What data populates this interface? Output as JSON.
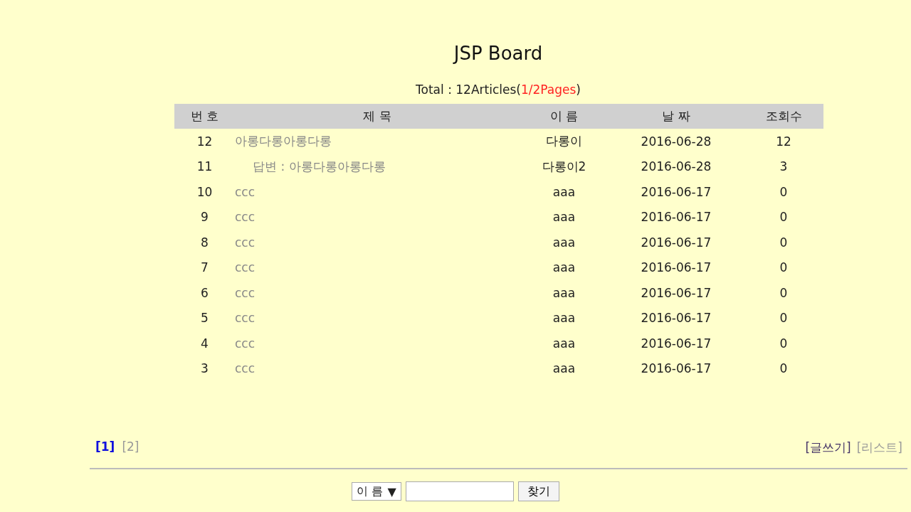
{
  "title": "JSP Board",
  "summary": {
    "total": "Total : 12Articles(",
    "pages": "1/2Pages",
    "close": ")"
  },
  "table": {
    "columns": [
      "번 호",
      "제 목",
      "이 름",
      "날 짜",
      "조회수"
    ],
    "rows": [
      {
        "no": "12",
        "title": "아롱다롱아롱다롱",
        "name": "다롱이",
        "date": "2016-06-28",
        "hits": "12",
        "children": [
          {
            "no": "11",
            "title": "답변 : 아롱다롱아롱다롱",
            "name": "다롱이2",
            "date": "2016-06-28",
            "hits": "3"
          }
        ]
      },
      {
        "no": "10",
        "title": "ccc",
        "name": "aaa",
        "date": "2016-06-17",
        "hits": "0"
      },
      {
        "no": "9",
        "title": "ccc",
        "name": "aaa",
        "date": "2016-06-17",
        "hits": "0"
      },
      {
        "no": "8",
        "title": "ccc",
        "name": "aaa",
        "date": "2016-06-17",
        "hits": "0"
      },
      {
        "no": "7",
        "title": "ccc",
        "name": "aaa",
        "date": "2016-06-17",
        "hits": "0"
      },
      {
        "no": "6",
        "title": "ccc",
        "name": "aaa",
        "date": "2016-06-17",
        "hits": "0"
      },
      {
        "no": "5",
        "title": "ccc",
        "name": "aaa",
        "date": "2016-06-17",
        "hits": "0"
      },
      {
        "no": "4",
        "title": "ccc",
        "name": "aaa",
        "date": "2016-06-17",
        "hits": "0"
      },
      {
        "no": "3",
        "title": "ccc",
        "name": "aaa",
        "date": "2016-06-17",
        "hits": "0"
      }
    ]
  },
  "pagination": [
    {
      "label": "[1]",
      "selected": true
    },
    {
      "label": "[2]",
      "selected": false
    }
  ],
  "actions": [
    {
      "label": "[글쓰기]",
      "visited": true
    },
    {
      "label": "[리스트]",
      "visited": false
    }
  ],
  "search": {
    "field": "이 름",
    "caret": "▼",
    "button": "찾기"
  }
}
